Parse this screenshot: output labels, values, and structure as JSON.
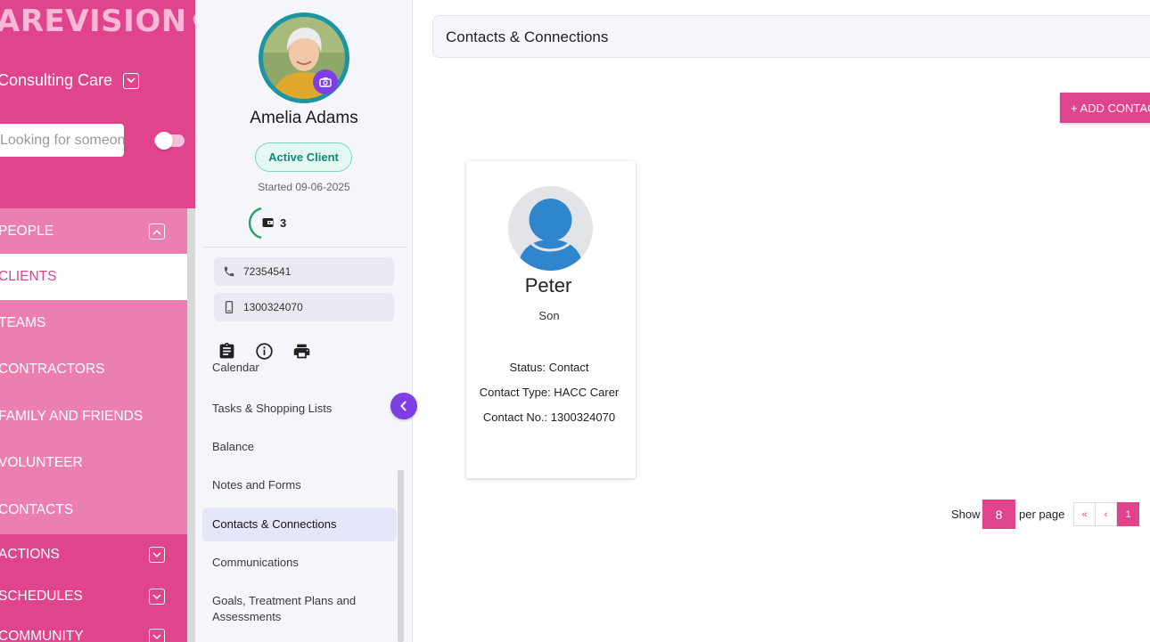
{
  "sidebar": {
    "logo_text": "AREVISION",
    "org_name": "Consulting Care",
    "search_placeholder": "Looking for someone?",
    "sections": [
      {
        "label": "PEOPLE"
      },
      {
        "label": "ACTIONS"
      },
      {
        "label": "SCHEDULES"
      },
      {
        "label": "COMMUNITY"
      }
    ],
    "people_items": [
      {
        "label": "CLIENTS"
      },
      {
        "label": "TEAMS"
      },
      {
        "label": "CONTRACTORS"
      },
      {
        "label": "FAMILY AND FRIENDS"
      },
      {
        "label": "VOLUNTEER"
      },
      {
        "label": "CONTACTS"
      }
    ]
  },
  "profile": {
    "name": "Amelia Adams",
    "status": "Active Client",
    "started": "Started 09-06-2025",
    "wallet_count": "3",
    "phone": "72354541",
    "mobile": "1300324070",
    "menu": [
      {
        "label": "Calendar"
      },
      {
        "label": "Tasks & Shopping Lists"
      },
      {
        "label": "Balance"
      },
      {
        "label": "Notes and Forms"
      },
      {
        "label": "Contacts & Connections"
      },
      {
        "label": "Communications"
      },
      {
        "label": "Goals, Treatment Plans and Assessments"
      }
    ]
  },
  "main": {
    "title": "Contacts & Connections",
    "add_button": "+ ADD CONTACT",
    "contact": {
      "name": "Peter",
      "relation": "Son",
      "status": "Status: Contact",
      "type": "Contact Type: HACC Carer",
      "number": "Contact No.: 1300324070"
    },
    "pagination": {
      "show": "Show",
      "per_page_value": "8",
      "per_page": "per page",
      "first": "«",
      "prev": "‹",
      "current": "1"
    }
  },
  "colors": {
    "brand_pink": "#e0448d",
    "sidebar_light": "#ec7fb1",
    "accent_purple": "#7e3ee6",
    "active_green": "#11897a"
  }
}
